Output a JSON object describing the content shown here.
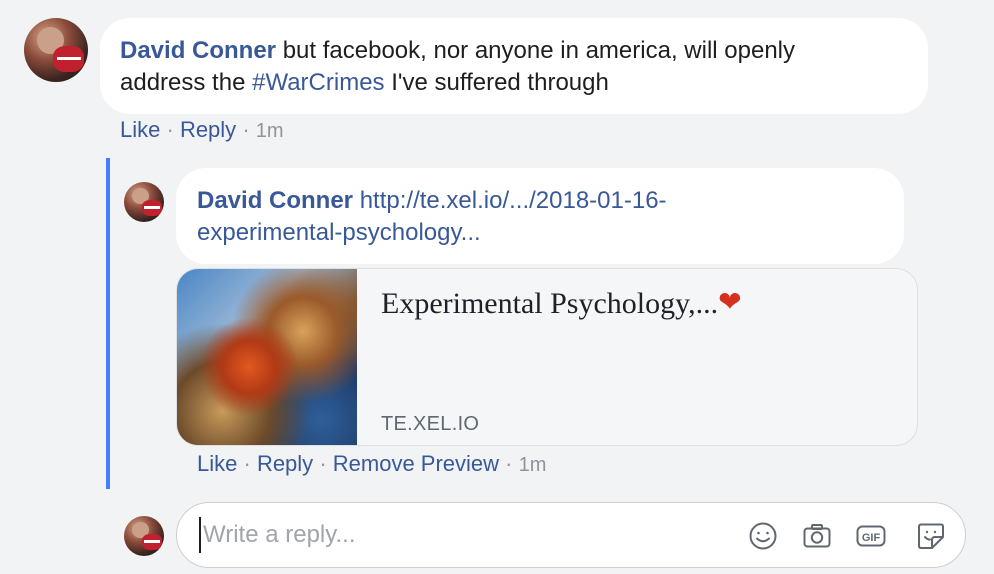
{
  "comment": {
    "author": "David Conner",
    "text_before": " but facebook, nor anyone in america, will openly",
    "text_line2_before": "address the ",
    "hashtag": "#WarCrimes",
    "text_after": " I've suffered through",
    "actions": {
      "like": "Like",
      "reply": "Reply",
      "separator": "·",
      "time": "1m"
    }
  },
  "reply": {
    "author": "David Conner",
    "link_line1": "http://te.xel.io/.../2018-01-16-",
    "link_line2": "experimental-psychology...",
    "preview": {
      "title": "Experimental Psychology,...",
      "emoji": "❤",
      "domain": "TE.XEL.IO"
    },
    "actions": {
      "like": "Like",
      "reply": "Reply",
      "remove_preview": "Remove Preview",
      "separator": "·",
      "time": "1m"
    }
  },
  "composer": {
    "placeholder": "Write a reply...",
    "icons": [
      "emoji-icon",
      "camera-icon",
      "gif-icon",
      "sticker-icon"
    ],
    "gif_label": "GIF"
  },
  "colors": {
    "link_blue": "#385898",
    "thread_line": "#4080ff",
    "meta_gray": "#90949c",
    "background": "#f2f3f5"
  }
}
